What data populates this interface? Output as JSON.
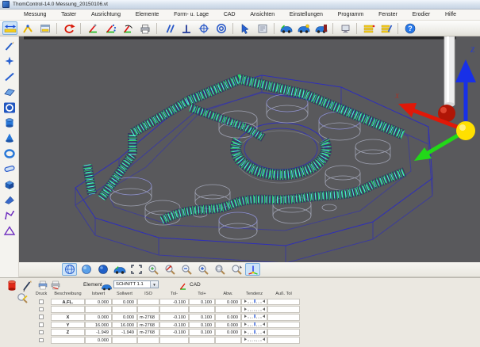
{
  "window": {
    "title": "ThomControl-14.0   Messung_20150106.vt"
  },
  "menu": {
    "items": [
      "Messung",
      "Taster",
      "Ausrichtung",
      "Elemente",
      "Form- u. Lage",
      "CAD",
      "Ansichten",
      "Einstellungen",
      "Programm",
      "Fenster",
      "Erodier",
      "Hilfe"
    ]
  },
  "toolbar": {
    "icons": [
      "measure-distance",
      "measure-angle",
      "measure-window",
      "recalculate",
      "align-sequence",
      "align-321",
      "align-rps",
      "print-protocol",
      "parallelism",
      "perpendicularity",
      "position",
      "concentricity",
      "cad-pick",
      "cad-report",
      "cad-import",
      "cad-compare",
      "cad-export",
      "display",
      "feature-list",
      "feature-edit",
      "help"
    ]
  },
  "sidebar": {
    "icons": [
      "probe",
      "point",
      "line",
      "plane",
      "circle",
      "cylinder",
      "cone",
      "sphere",
      "slot",
      "box",
      "wedge",
      "profile",
      "triangle"
    ]
  },
  "viewport": {
    "background": "#59595c",
    "wireframe_color": "#2c2cc0",
    "scan_colors": {
      "green": "#2ad565",
      "cyan": "#52e8e0"
    },
    "axis_labels": {
      "z": "Z",
      "x": "X"
    },
    "axis_colors": {
      "x": "#e01808",
      "y": "#22d818",
      "z": "#1830e8",
      "origin": "#ffe000",
      "probe_tip": "#c41804"
    }
  },
  "view_toolbar": {
    "icons": [
      "view-wireframe",
      "view-shaded",
      "view-smooth",
      "view-vehicle",
      "zoom-fit",
      "zoom-in",
      "zoom-dynamic",
      "zoom-out",
      "zoom-plus",
      "zoom-window",
      "zoom-select",
      "view-axes"
    ]
  },
  "panel": {
    "toolbar_icons": [
      "feature-cylinder",
      "edit-pen",
      "print-preview",
      "print-red",
      "element-vehicle",
      "axes-small",
      "zoom-edit"
    ],
    "element_label": "Element",
    "element_value": "SCHNITT 1.1",
    "cad_label": "CAD",
    "table": {
      "headers": [
        "Druck",
        "Beschreibung",
        "Istwert",
        "Sollwert",
        "ISO",
        "Tol-",
        "Tol+",
        "Abw.",
        "Tendenz",
        "Auß. Tol"
      ],
      "rows": [
        {
          "beschreibung": "A.FL.",
          "istwert": "0.000",
          "sollwert": "0.000",
          "iso": "",
          "tol_minus": "-0.100",
          "tol_plus": "0.100",
          "abw": "0.000",
          "tendenz_marker": true,
          "aus_tol": ""
        },
        {
          "beschreibung": "",
          "istwert": "",
          "sollwert": "",
          "iso": "",
          "tol_minus": "",
          "tol_plus": "",
          "abw": "",
          "tendenz_marker": false,
          "aus_tol": ""
        },
        {
          "beschreibung": "X",
          "istwert": "0.000",
          "sollwert": "0.000",
          "iso": "m-2768",
          "tol_minus": "-0.100",
          "tol_plus": "0.100",
          "abw": "0.000",
          "tendenz_marker": true,
          "aus_tol": ""
        },
        {
          "beschreibung": "Y",
          "istwert": "16.000",
          "sollwert": "16.000",
          "iso": "m-2768",
          "tol_minus": "-0.100",
          "tol_plus": "0.100",
          "abw": "0.000",
          "tendenz_marker": true,
          "aus_tol": ""
        },
        {
          "beschreibung": "Z",
          "istwert": "-1.949",
          "sollwert": "-1.949",
          "iso": "m-2768",
          "tol_minus": "-0.100",
          "tol_plus": "0.100",
          "abw": "0.000",
          "tendenz_marker": true,
          "aus_tol": ""
        },
        {
          "beschreibung": "",
          "istwert": "0.000",
          "sollwert": "",
          "iso": "",
          "tol_minus": "",
          "tol_plus": "",
          "abw": "",
          "tendenz_marker": false,
          "aus_tol": ""
        }
      ]
    }
  }
}
